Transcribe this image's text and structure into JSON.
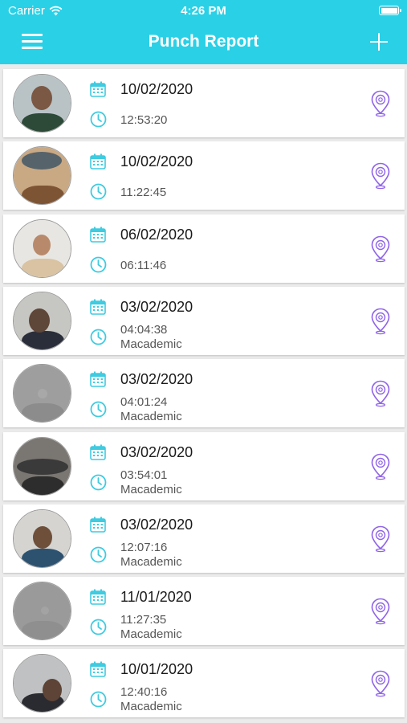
{
  "status_bar": {
    "carrier": "Carrier",
    "time": "4:26 PM"
  },
  "nav": {
    "title": "Punch Report"
  },
  "colors": {
    "header": "#2ad0e6",
    "icon_accent": "#3fcbe0",
    "pin": "#8f63e8"
  },
  "icons": {
    "menu": "menu-icon",
    "add": "plus-icon",
    "date": "calendar-icon",
    "time": "clock-icon",
    "location": "location-pin-icon"
  },
  "punches": [
    {
      "date": "10/02/2020",
      "time": "12:53:20",
      "location": ""
    },
    {
      "date": "10/02/2020",
      "time": "11:22:45",
      "location": ""
    },
    {
      "date": "06/02/2020",
      "time": "06:11:46",
      "location": ""
    },
    {
      "date": "03/02/2020",
      "time": "04:04:38",
      "location": "Macademic"
    },
    {
      "date": "03/02/2020",
      "time": "04:01:24",
      "location": "Macademic"
    },
    {
      "date": "03/02/2020",
      "time": "03:54:01",
      "location": "Macademic"
    },
    {
      "date": "03/02/2020",
      "time": "12:07:16",
      "location": "Macademic"
    },
    {
      "date": "11/01/2020",
      "time": "11:27:35",
      "location": "Macademic"
    },
    {
      "date": "10/01/2020",
      "time": "12:40:16",
      "location": "Macademic"
    }
  ]
}
